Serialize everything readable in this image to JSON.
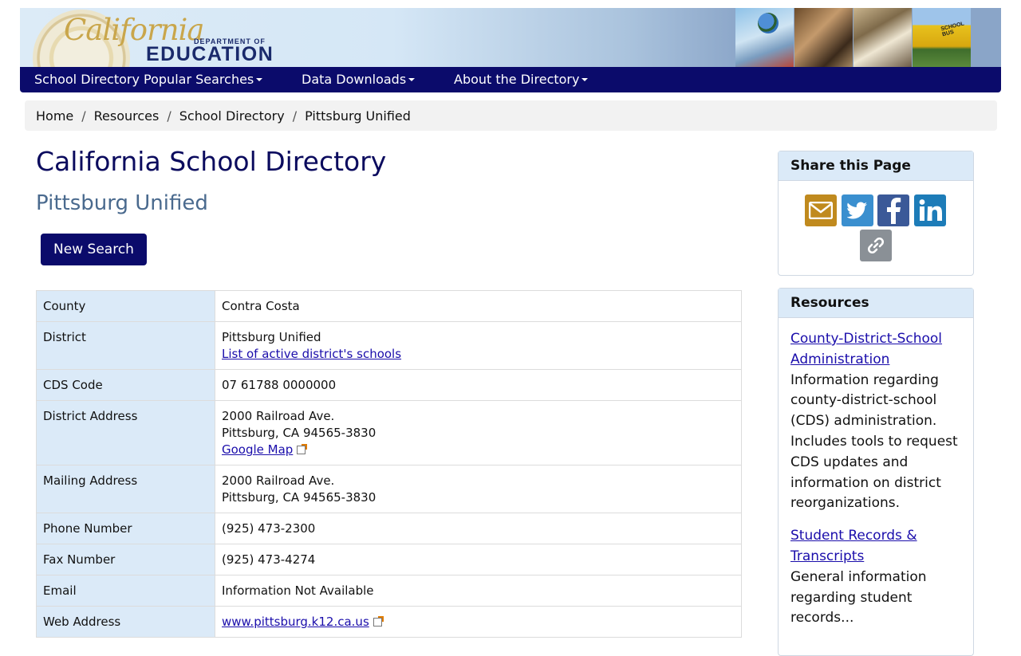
{
  "banner": {
    "logo_script": "California",
    "logo_dept": "DEPARTMENT OF",
    "logo_edu": "EDUCATION",
    "photo_sign": "SCHOOL BUS"
  },
  "nav": {
    "items": [
      {
        "label": "School Directory Popular Searches"
      },
      {
        "label": "Data Downloads"
      },
      {
        "label": "About the Directory"
      }
    ]
  },
  "breadcrumb": [
    "Home",
    "Resources",
    "School Directory",
    "Pittsburg Unified"
  ],
  "page": {
    "title": "California School Directory",
    "subtitle": "Pittsburg Unified",
    "new_search": "New Search"
  },
  "details": {
    "county_label": "County",
    "county": "Contra Costa",
    "district_label": "District",
    "district": "Pittsburg Unified",
    "district_link": "List of active district's schools",
    "cds_label": "CDS Code",
    "cds": "07 61788 0000000",
    "district_address_label": "District Address",
    "district_address_line1": "2000 Railroad Ave.",
    "district_address_line2": "Pittsburg, CA 94565-3830",
    "map_link": "Google Map",
    "mailing_address_label": "Mailing Address",
    "mailing_address_line1": "2000 Railroad Ave.",
    "mailing_address_line2": "Pittsburg, CA 94565-3830",
    "phone_label": "Phone Number",
    "phone": "(925) 473-2300",
    "fax_label": "Fax Number",
    "fax": "(925) 473-4274",
    "email_label": "Email",
    "email": "Information Not Available",
    "web_label": "Web Address",
    "web": "www.pittsburg.k12.ca.us"
  },
  "share": {
    "heading": "Share this Page",
    "colors": {
      "email": "#c08a1e",
      "twitter": "#3a8fcf",
      "facebook": "#3b5998",
      "linkedin": "#1d7cb8",
      "link": "#8a9096"
    }
  },
  "resources": {
    "heading": "Resources",
    "items": [
      {
        "title": "County-District-School Administration",
        "desc": "Information regarding county-district-school (CDS) administration. Includes tools to request CDS updates and information on district reorganizations."
      },
      {
        "title": "Student Records & Transcripts",
        "desc": "General information regarding student records..."
      }
    ]
  },
  "theme": {
    "navy": "#0b0b6b",
    "label_bg": "#dbeaf8"
  }
}
